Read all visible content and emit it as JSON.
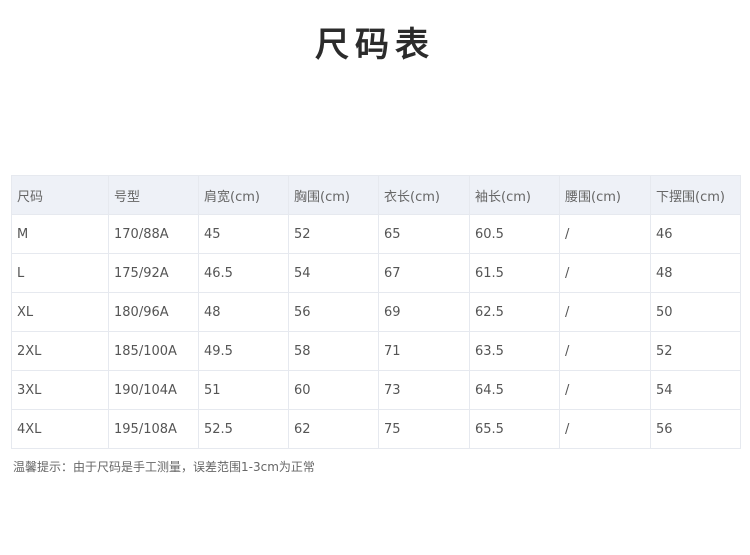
{
  "title": "尺码表",
  "table": {
    "headers": [
      "尺码",
      "号型",
      "肩宽(cm)",
      "胸围(cm)",
      "衣长(cm)",
      "袖长(cm)",
      "腰围(cm)",
      "下摆围(cm)"
    ],
    "rows": [
      [
        "M",
        "170/88A",
        "45",
        "52",
        "65",
        "60.5",
        "/",
        "46"
      ],
      [
        "L",
        "175/92A",
        "46.5",
        "54",
        "67",
        "61.5",
        "/",
        "48"
      ],
      [
        "XL",
        "180/96A",
        "48",
        "56",
        "69",
        "62.5",
        "/",
        "50"
      ],
      [
        "2XL",
        "185/100A",
        "49.5",
        "58",
        "71",
        "63.5",
        "/",
        "52"
      ],
      [
        "3XL",
        "190/104A",
        "51",
        "60",
        "73",
        "64.5",
        "/",
        "54"
      ],
      [
        "4XL",
        "195/108A",
        "52.5",
        "62",
        "75",
        "65.5",
        "/",
        "56"
      ]
    ]
  },
  "note": "温馨提示：由于尺码是手工测量，误差范围1-3cm为正常",
  "colors": {
    "header_background": "#eef1f7",
    "border": "#e6e9ef",
    "title_text": "#2b2b2b",
    "body_text": "#555555"
  }
}
